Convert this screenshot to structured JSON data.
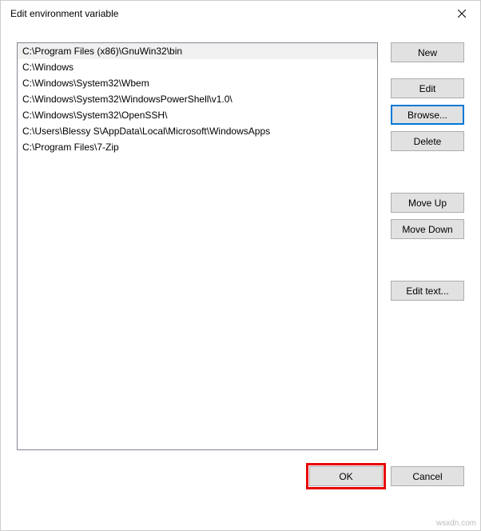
{
  "window": {
    "title": "Edit environment variable"
  },
  "list": {
    "items": [
      "C:\\Program Files (x86)\\GnuWin32\\bin",
      "C:\\Windows",
      "C:\\Windows\\System32\\Wbem",
      "C:\\Windows\\System32\\WindowsPowerShell\\v1.0\\",
      "C:\\Windows\\System32\\OpenSSH\\",
      "C:\\Users\\Blessy S\\AppData\\Local\\Microsoft\\WindowsApps",
      "C:\\Program Files\\7-Zip"
    ],
    "selected_index": 0
  },
  "buttons": {
    "new": "New",
    "edit": "Edit",
    "browse": "Browse...",
    "delete": "Delete",
    "move_up": "Move Up",
    "move_down": "Move Down",
    "edit_text": "Edit text...",
    "ok": "OK",
    "cancel": "Cancel"
  },
  "watermark": "wsxdn.com"
}
